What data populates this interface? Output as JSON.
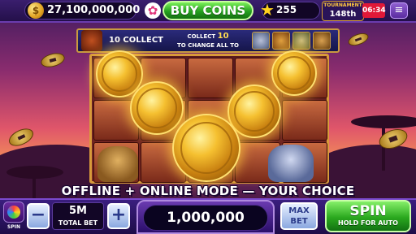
{
  "topbar": {
    "coins": "27,100,000,000",
    "coin_icon": "$",
    "buy_label": "BUY COINS",
    "stars": "255",
    "tournament_label": "TOURNAMENT",
    "tournament_rank": "148th",
    "timer": "06:34"
  },
  "banner": {
    "collect_label": "10 COLLECT",
    "collect_line": "COLLECT",
    "collect_count": "10",
    "change_line": "TO CHANGE ALL",
    "to_label": "TO"
  },
  "promo": "OFFLINE + ONLINE MODE — YOUR CHOICE",
  "bottom": {
    "spin_small_label": "SPIN",
    "minus": "−",
    "plus": "+",
    "total_bet_value": "5M",
    "total_bet_label": "TOTAL BET",
    "win_value": "1,000,000",
    "maxbet_line1": "MAX",
    "maxbet_line2": "BET",
    "spin_label": "SPIN",
    "spin_sub": "HOLD FOR AUTO"
  },
  "colors": {
    "accent_green": "#25a020",
    "accent_purple": "#3a1e6e",
    "gold": "#f5c030",
    "timer_red": "#e01838"
  },
  "icons": [
    "coin-icon",
    "flower-icon",
    "star-icon",
    "menu-icon",
    "buffalo-icon",
    "wolf-icon",
    "tiger-icon",
    "lion-icon",
    "spin-wheel-icon"
  ]
}
